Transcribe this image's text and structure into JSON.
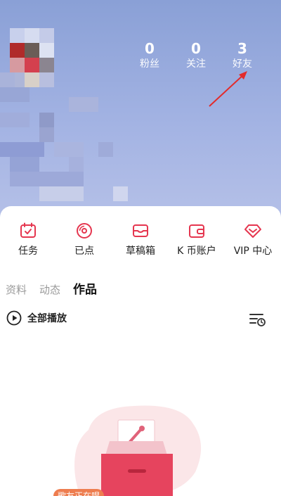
{
  "stats": [
    {
      "value": "0",
      "label": "粉丝"
    },
    {
      "value": "0",
      "label": "关注"
    },
    {
      "value": "3",
      "label": "好友"
    }
  ],
  "actions": [
    {
      "label": "任务",
      "icon": "calendar-icon"
    },
    {
      "label": "已点",
      "icon": "disc-icon"
    },
    {
      "label": "草稿箱",
      "icon": "inbox-icon"
    },
    {
      "label": "K 币账户",
      "icon": "wallet-icon"
    },
    {
      "label": "VIP 中心",
      "icon": "diamond-icon"
    }
  ],
  "tabs": [
    {
      "label": "资料"
    },
    {
      "label": "动态"
    },
    {
      "label": "作品"
    }
  ],
  "active_tab": "作品",
  "play_all": {
    "label": "全部播放"
  },
  "empty_badge": "歌友正在唱",
  "colors": {
    "accent": "#e5364f",
    "header": "#9aace0",
    "arrow": "#e32b2b",
    "badge": "#ee7d4f"
  }
}
